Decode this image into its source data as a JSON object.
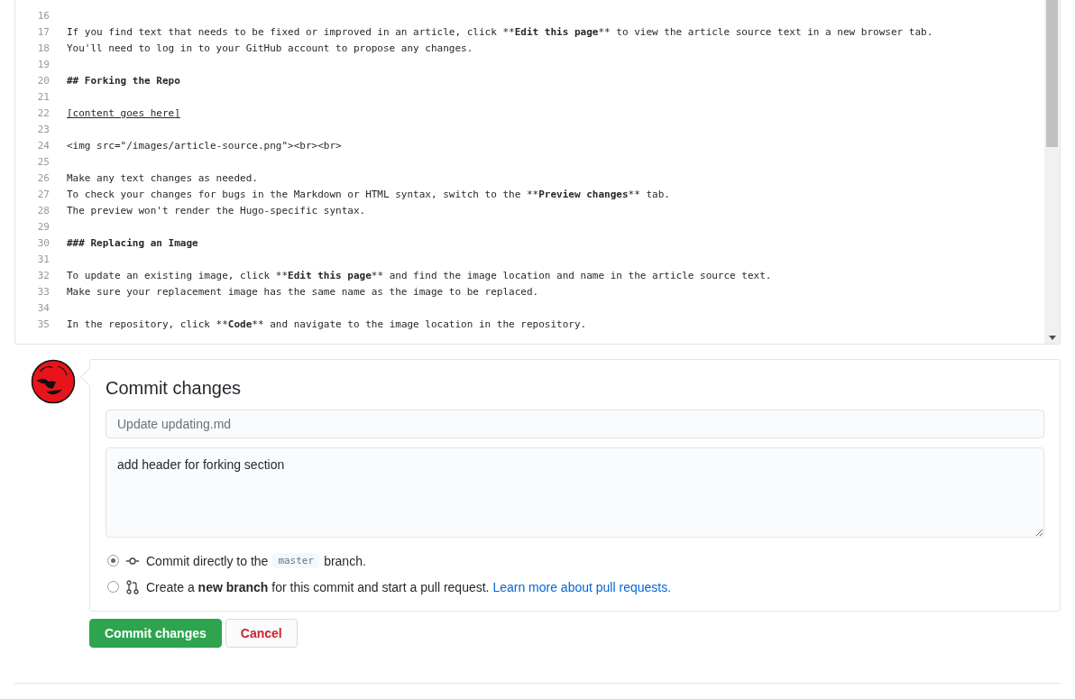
{
  "editor": {
    "lines": [
      {
        "number": "16"
      },
      {
        "number": "17",
        "segments": [
          {
            "text": "If you find text that needs to be fixed or improved in an article, click **",
            "kind": "plain"
          },
          {
            "text": "Edit this page",
            "kind": "bold"
          },
          {
            "text": "** to view the article source text in a new browser tab.",
            "kind": "plain"
          }
        ]
      },
      {
        "number": "18",
        "segments": [
          {
            "text": "You'll need to log in to your GitHub account to propose any changes.",
            "kind": "plain"
          }
        ]
      },
      {
        "number": "19"
      },
      {
        "number": "20",
        "segments": [
          {
            "text": "## Forking the Repo",
            "kind": "bold"
          }
        ]
      },
      {
        "number": "21"
      },
      {
        "number": "22",
        "segments": [
          {
            "text": "[content goes here]",
            "kind": "link"
          }
        ]
      },
      {
        "number": "23"
      },
      {
        "number": "24",
        "segments": [
          {
            "text": "<img src=\"/images/article-source.png\"><br><br>",
            "kind": "plain"
          }
        ]
      },
      {
        "number": "25"
      },
      {
        "number": "26",
        "segments": [
          {
            "text": "Make any text changes as needed.",
            "kind": "plain"
          }
        ]
      },
      {
        "number": "27",
        "segments": [
          {
            "text": "To check your changes for bugs in the Markdown or HTML syntax, switch to the **",
            "kind": "plain"
          },
          {
            "text": "Preview changes",
            "kind": "bold"
          },
          {
            "text": "** tab.",
            "kind": "plain"
          }
        ]
      },
      {
        "number": "28",
        "segments": [
          {
            "text": "The preview won't render the Hugo-specific syntax.",
            "kind": "plain"
          }
        ]
      },
      {
        "number": "29"
      },
      {
        "number": "30",
        "segments": [
          {
            "text": "### Replacing an Image",
            "kind": "bold"
          }
        ]
      },
      {
        "number": "31"
      },
      {
        "number": "32",
        "segments": [
          {
            "text": "To update an existing image, click **",
            "kind": "plain"
          },
          {
            "text": "Edit this page",
            "kind": "bold"
          },
          {
            "text": "** and find the image location and name in the article source text.",
            "kind": "plain"
          }
        ]
      },
      {
        "number": "33",
        "segments": [
          {
            "text": "Make sure your replacement image has the same name as the image to be replaced.",
            "kind": "plain"
          }
        ]
      },
      {
        "number": "34"
      },
      {
        "number": "35",
        "segments": [
          {
            "text": "In the repository, click **",
            "kind": "plain"
          },
          {
            "text": "Code",
            "kind": "bold"
          },
          {
            "text": "** and navigate to the image location in the repository.",
            "kind": "plain"
          }
        ]
      }
    ]
  },
  "commit": {
    "title": "Commit changes",
    "summary": {
      "placeholder": "Update updating.md"
    },
    "description": {
      "value": "add header for forking section"
    },
    "options": [
      {
        "kind": "direct",
        "selected": true,
        "before": "Commit directly to the",
        "branch": "master",
        "after": "branch."
      },
      {
        "kind": "new_branch",
        "selected": false,
        "before": "Create a",
        "bold": "new branch",
        "after": "for this commit and start a pull request.",
        "link": "Learn more about pull requests."
      }
    ],
    "buttons": [
      {
        "kind": "primary",
        "label": "Commit changes"
      },
      {
        "kind": "cancel",
        "label": "Cancel"
      }
    ]
  }
}
